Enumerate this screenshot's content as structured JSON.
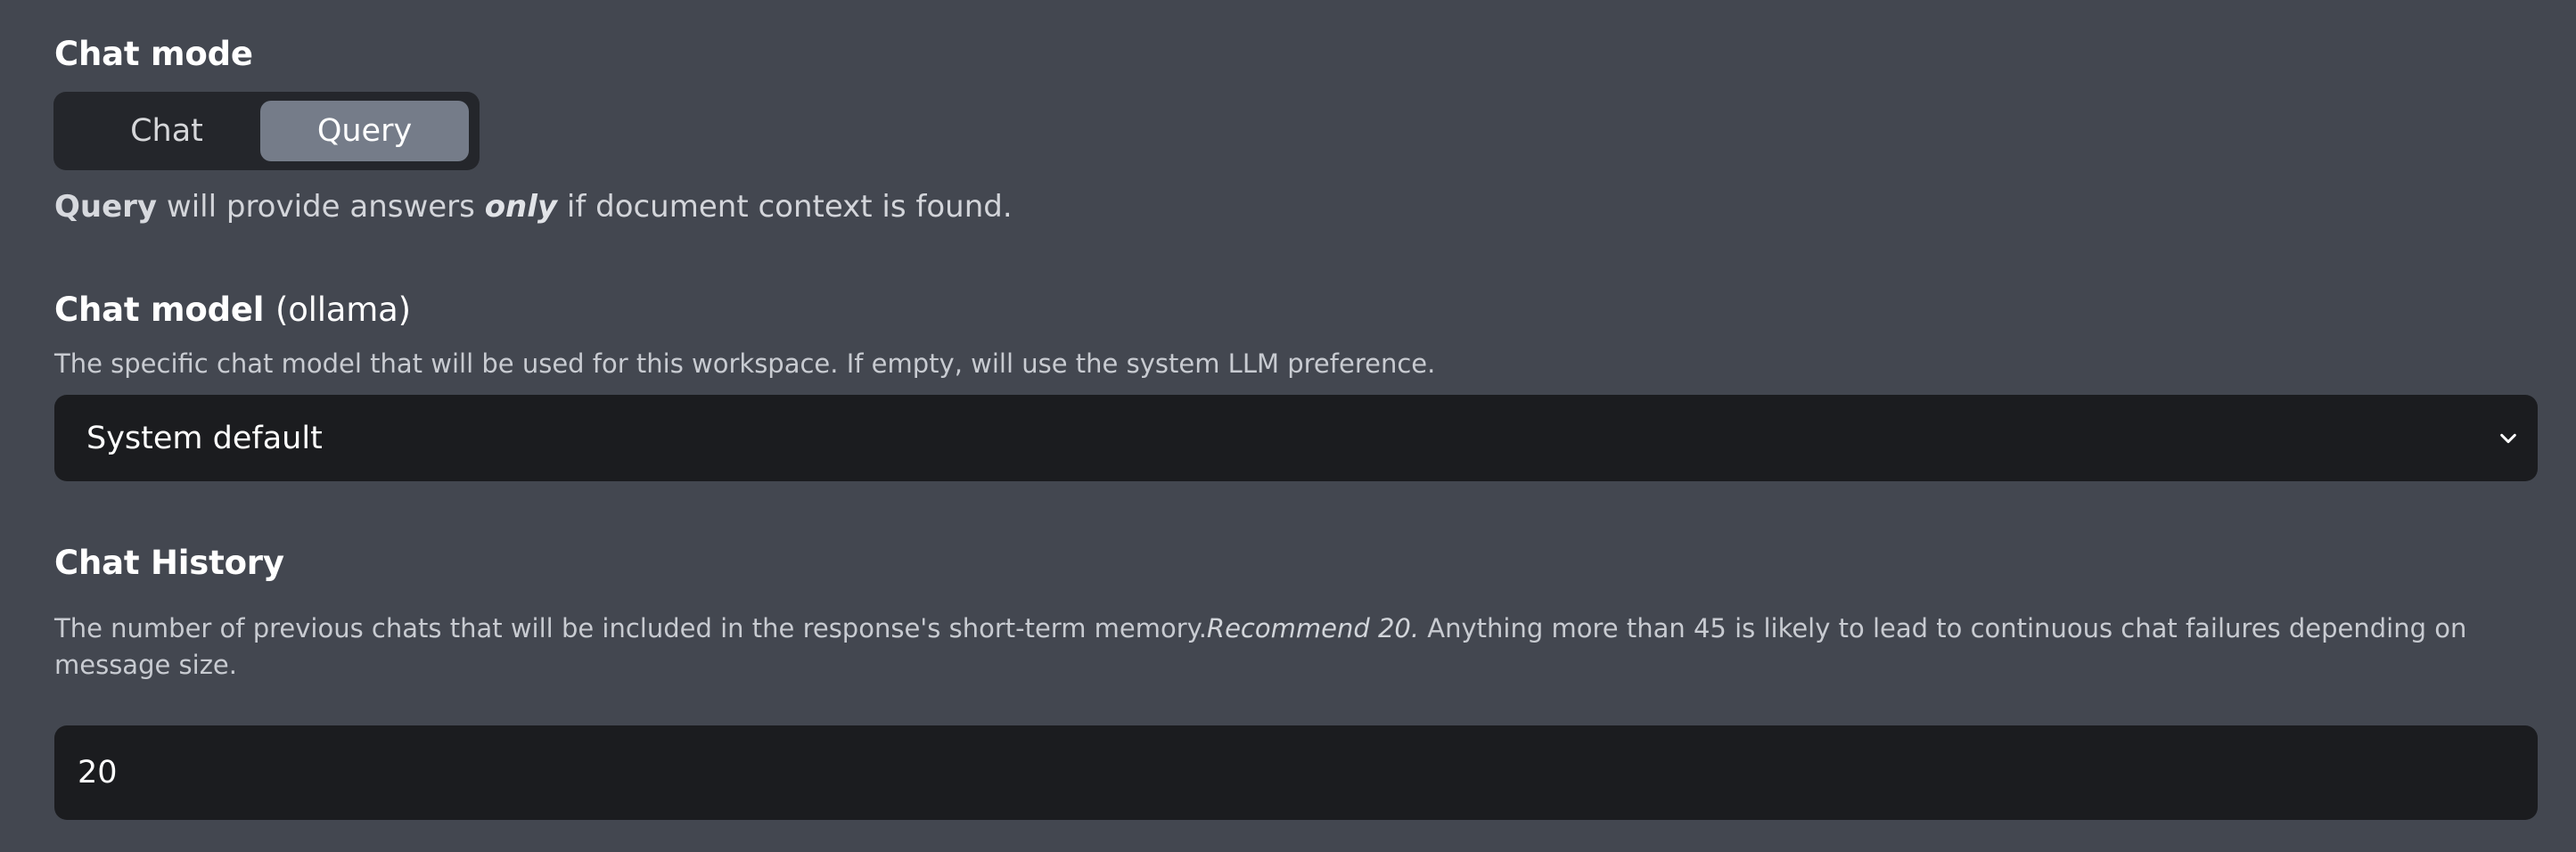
{
  "chat_mode": {
    "title": "Chat mode",
    "options": [
      "Chat",
      "Query"
    ],
    "selected": "Query",
    "helper": {
      "bold": "Query",
      "before": " will provide answers ",
      "emphasis": "only",
      "after": " if document context is found."
    }
  },
  "chat_model": {
    "title_main": "Chat model",
    "title_provider": "(ollama)",
    "description": "The specific chat model that will be used for this workspace. If empty, will use the system LLM preference.",
    "selected_value": "System default",
    "dropdown_icon": "chevron-down-icon"
  },
  "chat_history": {
    "title": "Chat History",
    "description_part1": "The number of previous chats that will be included in the response's short-term memory.",
    "description_recommend": "Recommend 20.",
    "description_part2": " Anything more than 45 is likely to lead to continuous chat failures depending on message size.",
    "value": "20"
  },
  "colors": {
    "background": "#434750",
    "toggle_bg": "#24262b",
    "toggle_active": "#757c89",
    "field_bg": "#1b1c1f"
  }
}
